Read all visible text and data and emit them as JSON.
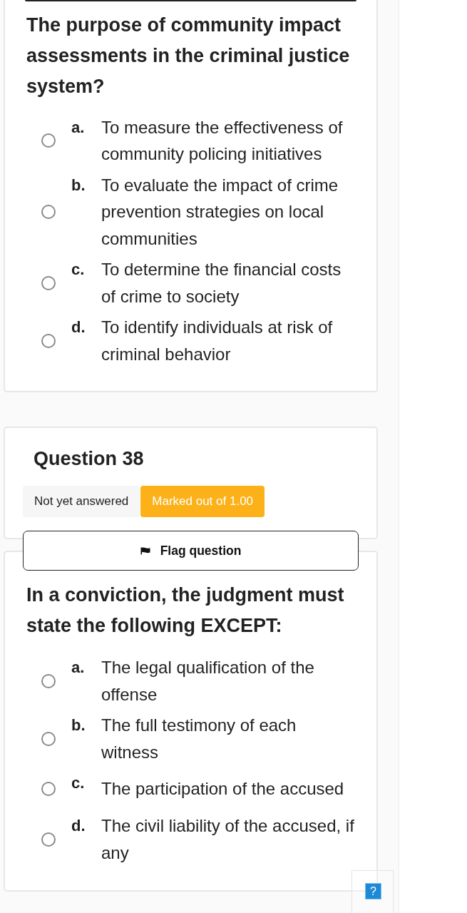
{
  "previous_question": {
    "text": "The purpose of community impact assessments in the criminal justice system?",
    "options": [
      {
        "letter": "a.",
        "text": "To measure the effectiveness of community policing initiatives",
        "selected": false
      },
      {
        "letter": "b.",
        "text": "To evaluate the impact of crime prevention strategies on local communities",
        "selected": false
      },
      {
        "letter": "c.",
        "text": "To determine the financial costs of crime to society",
        "selected": false
      },
      {
        "letter": "d.",
        "text": "To identify individuals at risk of criminal behavior",
        "selected": false
      }
    ]
  },
  "question": {
    "title": "Question 38",
    "status": "Not yet answered",
    "marks": "Marked out of 1.00",
    "flag_button": {
      "label": "Flag question"
    },
    "text": "In a conviction, the judgment must state the following EXCEPT:",
    "options": [
      {
        "letter": "a.",
        "text": "The legal qualification of the offense",
        "selected": false
      },
      {
        "letter": "b.",
        "text": "The full testimony of each witness",
        "selected": false
      },
      {
        "letter": "c.",
        "text": "The participation of the accused",
        "selected": false
      },
      {
        "letter": "d.",
        "text": "The civil liability of the accused, if any",
        "selected": false
      }
    ]
  },
  "help_button": {
    "label": "?"
  }
}
